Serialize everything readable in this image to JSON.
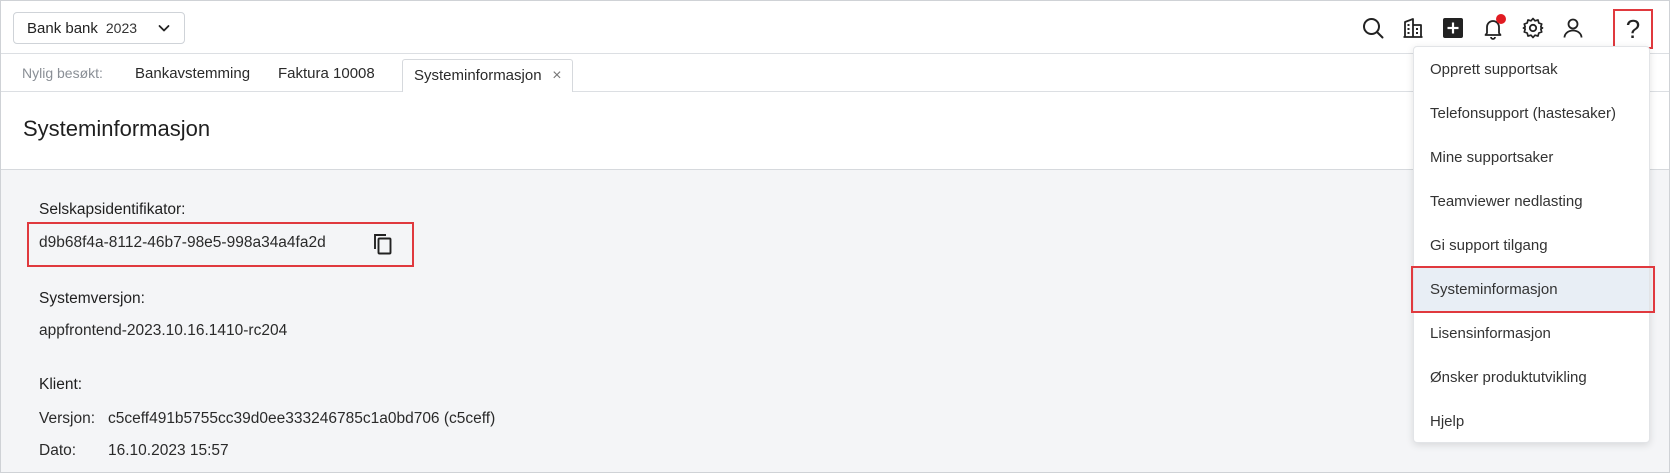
{
  "company_selector": {
    "name": "Bank bank",
    "year": "2023"
  },
  "icons": [
    "search-icon",
    "building-icon",
    "add-icon",
    "bell-icon",
    "gear-icon",
    "user-icon",
    "help-icon"
  ],
  "colors": {
    "highlight": "#e0393e",
    "notification": "#e11b22",
    "selected_bg": "#e8eef5"
  },
  "help_label": "?",
  "recent": {
    "label": "Nylig besøkt:",
    "tabs": [
      {
        "label": "Bankavstemming"
      },
      {
        "label": "Faktura 10008"
      },
      {
        "label": "Systeminformasjon",
        "active": true
      }
    ],
    "close_glyph": "×"
  },
  "page_title": "Systeminformasjon",
  "system_info": {
    "company_id_label": "Selskapsidentifikator:",
    "company_id": "d9b68f4a-8112-46b7-98e5-998a34a4fa2d",
    "version_label": "Systemversjon:",
    "version": "appfrontend-2023.10.16.1410-rc204",
    "client_label": "Klient:",
    "client_version_label": "Versjon:",
    "client_version": "c5ceff491b5755cc39d0ee333246785c1a0bd706 (c5ceff)",
    "client_date_label": "Dato:",
    "client_date": "16.10.2023 15:57"
  },
  "help_menu": {
    "items": [
      "Opprett supportsak",
      "Telefonsupport (hastesaker)",
      "Mine supportsaker",
      "Teamviewer nedlasting",
      "Gi support tilgang",
      "Systeminformasjon",
      "Lisensinformasjon",
      "Ønsker produktutvikling",
      "Hjelp"
    ],
    "selected_index": 5
  }
}
